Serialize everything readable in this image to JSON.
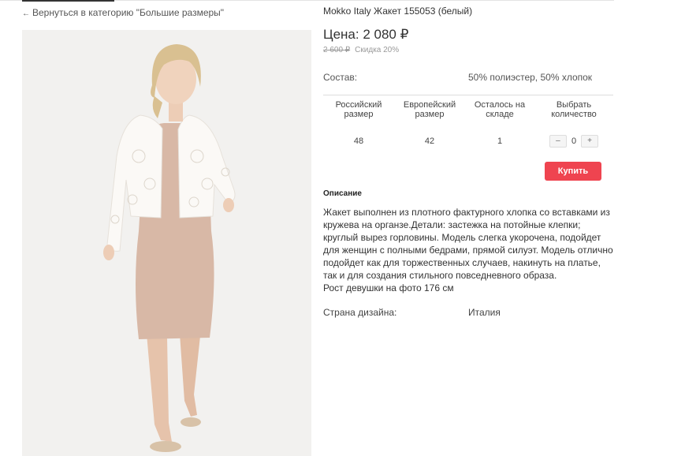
{
  "nav": {
    "back_text": "Вернуться в категорию \"Большие размеры\""
  },
  "product": {
    "title": "Mokko Italy Жакет 155053 (белый)",
    "price": "Цена: 2 080 ₽",
    "old_price": "2 600 ₽",
    "discount": "Скидка 20%",
    "composition_label": "Состав:",
    "composition_value": "50% полиэстер, 50% хлопок"
  },
  "sizes": {
    "headers": [
      "Российский размер",
      "Европейский размер",
      "Осталось на складе",
      "Выбрать количество"
    ],
    "row": {
      "ru": "48",
      "eu": "42",
      "stock": "1",
      "qty": "0"
    },
    "minus_label": "–",
    "plus_label": "+"
  },
  "buy_label": "Купить",
  "description": {
    "heading": "Описание",
    "lines": [
      "Жакет выполнен из плотного фактурного хлопка со вставками из",
      "кружева на органзе.Детали: застежка на потойные клепки;",
      "круглый вырез горловины. Модель слегка укорочена, подойдет",
      "для женщин с полными бедрами, прямой силуэт. Модель отлично",
      "подойдет как для торжественных случаев, накинуть на платье,",
      "так и для создания стильного повседневного образа.",
      "Рост девушки на фото 176 см"
    ]
  },
  "country": {
    "label": "Страна дизайна:",
    "value": "Италия"
  },
  "colors": {
    "accent": "#ef4450",
    "dress": "#d8b8a6",
    "jacket": "#fbf9f6",
    "background_photo": "#f2f1ef"
  }
}
